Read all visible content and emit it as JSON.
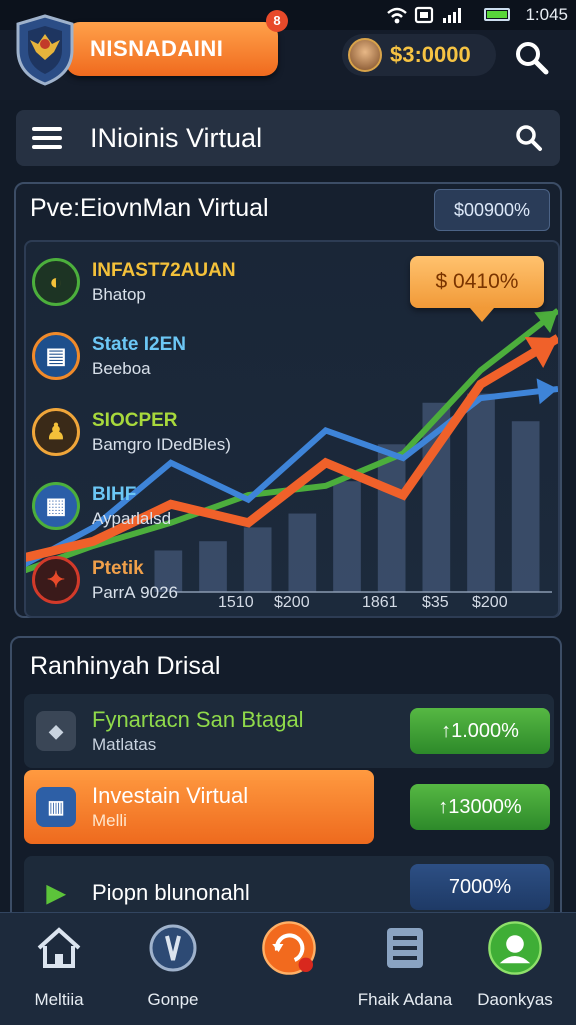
{
  "status": {
    "time": "1:045"
  },
  "header": {
    "brand": "NISNADAINI",
    "notif_count": "8",
    "balance": "$3:0000"
  },
  "search": {
    "title": "INioinis Virtual"
  },
  "chart_panel": {
    "title": "Pve:EiovnMan Virtual",
    "badge": "$00900%",
    "price_tag": "$ 0410%",
    "items": [
      {
        "name": "INFAST72AUAN",
        "sub": "Bhatop",
        "color": "#f4c13a"
      },
      {
        "name": "State I2EN",
        "sub": "Beeboa",
        "color": "#5ab8f0"
      },
      {
        "name": "SIOCPER",
        "sub": "Bamgro IDedBles)",
        "color": "#a8d93c"
      },
      {
        "name": "BIHF",
        "sub": "Ayparlalsd",
        "color": "#5ab8f0"
      },
      {
        "name": "Ptetik",
        "sub": "ParrА 9026",
        "color": "#f0a04a"
      }
    ],
    "xticks": [
      "1510",
      "$200",
      "1861",
      "$35",
      "$200"
    ]
  },
  "chart_data": {
    "type": "bar",
    "categories": [
      "1510",
      "$200",
      "1861",
      "$35",
      "$200"
    ],
    "values": [
      18,
      22,
      28,
      34,
      48,
      64,
      82,
      86,
      74
    ],
    "series": [
      {
        "name": "",
        "values": [
          14,
          22,
          38,
          30,
          56,
          42,
          90,
          110
        ]
      },
      {
        "name": "",
        "values": [
          10,
          28,
          56,
          40,
          70,
          58,
          84,
          88
        ]
      },
      {
        "name": "",
        "values": [
          8,
          20,
          30,
          42,
          46,
          60,
          96,
          122
        ]
      }
    ],
    "colors": [
      "#f0612a",
      "#3e84d8",
      "#4cae3c"
    ]
  },
  "list_panel": {
    "title": "Ranhinyah Drisal",
    "rows": [
      {
        "name": "Fynartacn San Btagal",
        "sub": "Matlatas",
        "value": "↑1.000%"
      },
      {
        "name": "Investain Virtual",
        "sub": "Melli",
        "value": "↑13000%"
      },
      {
        "name": "Piopn blunonahl",
        "sub": "",
        "value": "7000%"
      }
    ]
  },
  "nav": [
    {
      "label": "Meltiia",
      "icon": "home-icon"
    },
    {
      "label": "Gonpe",
      "icon": "compass-icon"
    },
    {
      "label": "",
      "icon": "refresh-icon"
    },
    {
      "label": "Fhaik Adana",
      "icon": "document-icon"
    },
    {
      "label": "Daonkyas",
      "icon": "profile-icon"
    }
  ]
}
